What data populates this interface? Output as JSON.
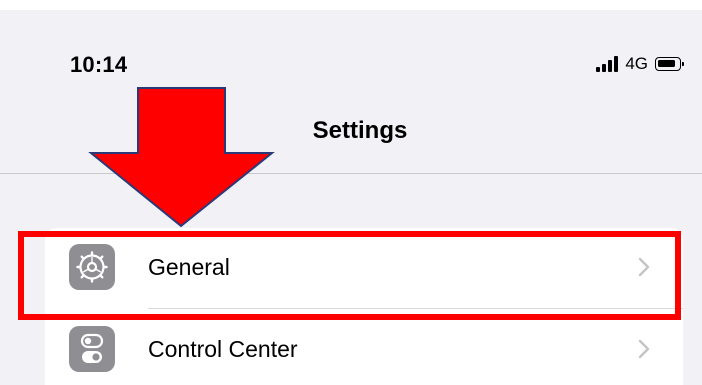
{
  "status_bar": {
    "time": "10:14",
    "network": "4G",
    "signal_icon": "cellular-signal-icon",
    "battery_icon": "battery-icon"
  },
  "nav": {
    "title": "Settings"
  },
  "settings_rows": [
    {
      "label": "General",
      "icon": "gear-icon",
      "chevron": "chevron-right-icon"
    },
    {
      "label": "Control Center",
      "icon": "toggle-switches-icon",
      "chevron": "chevron-right-icon"
    }
  ],
  "annotations": {
    "arrow_color": "#ff0000",
    "highlight_color": "#ff0000"
  },
  "colors": {
    "background": "#f2f2f6",
    "icon_gray": "#8e8e93",
    "chevron": "#c4c4c7"
  }
}
